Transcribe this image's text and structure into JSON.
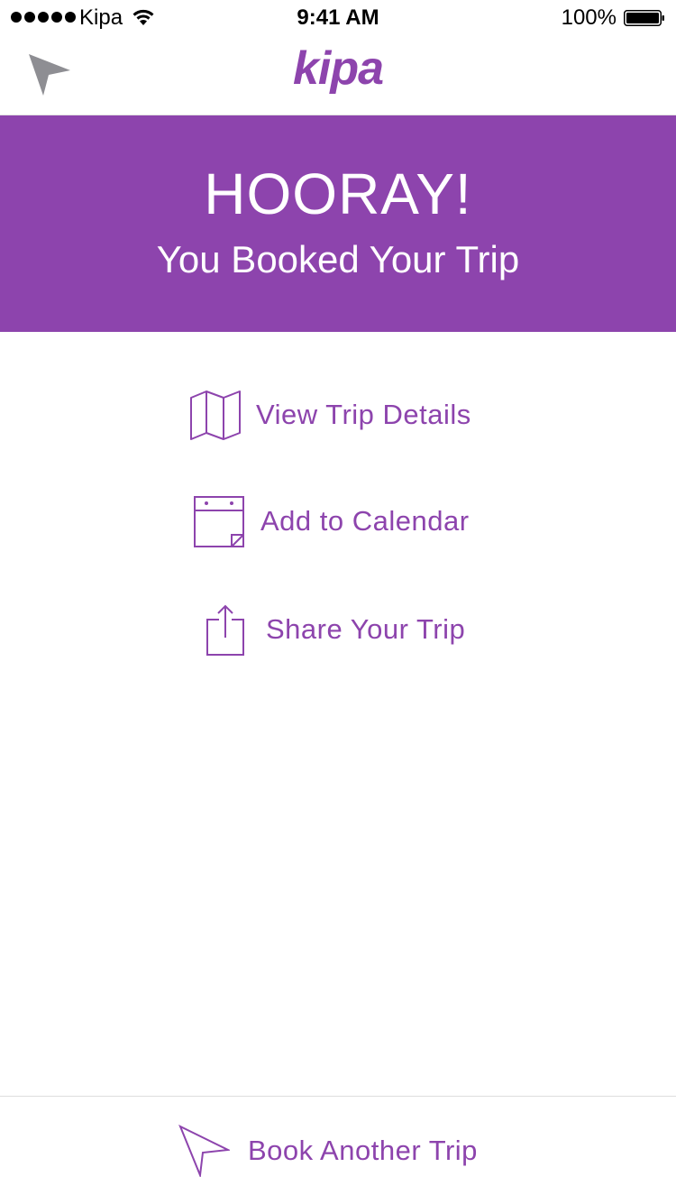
{
  "status_bar": {
    "carrier": "Kipa",
    "time": "9:41 AM",
    "battery": "100%"
  },
  "nav": {
    "logo": "kipa"
  },
  "banner": {
    "title": "HOORAY!",
    "subtitle": "You Booked Your Trip"
  },
  "actions": {
    "view_trip": "View Trip Details",
    "add_calendar": "Add to Calendar",
    "share_trip": "Share Your Trip"
  },
  "footer": {
    "book_another": "Book Another Trip"
  },
  "colors": {
    "accent": "#8d44ad",
    "nav_icon": "#8e8e93"
  },
  "icons": {
    "back": "location-arrow-icon",
    "trip": "map-icon",
    "calendar": "calendar-icon",
    "share": "share-icon",
    "book": "paper-plane-arrow-icon"
  }
}
